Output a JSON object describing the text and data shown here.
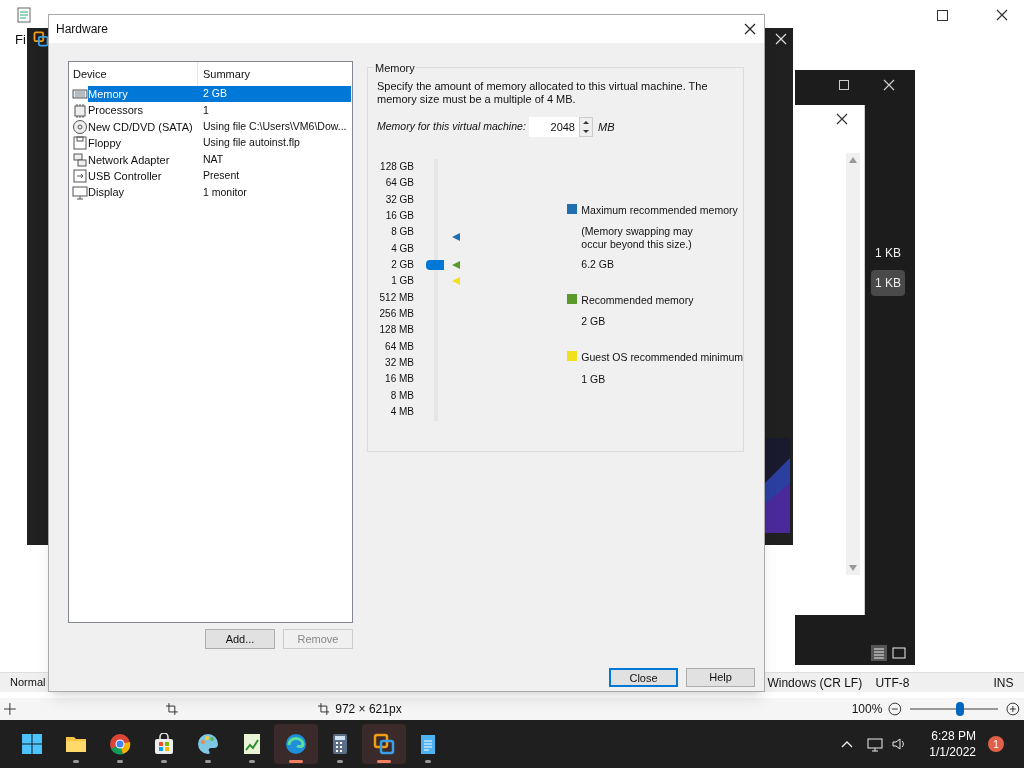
{
  "background_editor": {
    "menu_fragment": "Fi",
    "status_bar": [
      "Normal",
      "Windows (CR LF)",
      "UTF-8",
      "INS"
    ],
    "image_bar": {
      "size": "972 × 621px",
      "zoom": "100%",
      "level": 0.55
    }
  },
  "file_window": {
    "sizes": [
      {
        "text": "1 KB",
        "selected": false
      },
      {
        "text": "1 KB",
        "selected": true
      }
    ]
  },
  "hardware_dialog": {
    "title": "Hardware",
    "columns": [
      "Device",
      "Summary"
    ],
    "devices": [
      {
        "kind": "memory",
        "device": "Memory",
        "summary": "2 GB",
        "selected": true
      },
      {
        "kind": "cpu",
        "device": "Processors",
        "summary": "1",
        "selected": false
      },
      {
        "kind": "disc",
        "device": "New CD/DVD (SATA)",
        "summary": "Using file C:\\Users\\VM6\\Dow...",
        "selected": false
      },
      {
        "kind": "floppy",
        "device": "Floppy",
        "summary": "Using file autoinst.flp",
        "selected": false
      },
      {
        "kind": "network",
        "device": "Network Adapter",
        "summary": "NAT",
        "selected": false
      },
      {
        "kind": "usb",
        "device": "USB Controller",
        "summary": "Present",
        "selected": false
      },
      {
        "kind": "display",
        "device": "Display",
        "summary": "1 monitor",
        "selected": false
      }
    ],
    "list_buttons": [
      {
        "label": "Add...",
        "disabled": false
      },
      {
        "label": "Remove",
        "disabled": true
      }
    ],
    "memory": {
      "group": "Memory",
      "description": "Specify the amount of memory allocated to this virtual machine. The memory size must be a multiple of 4 MB.",
      "field_label": "Memory for this virtual machine:",
      "value": "2048",
      "unit": "MB",
      "scale": [
        "128 GB",
        "64 GB",
        "32 GB",
        "16 GB",
        "8 GB",
        "4 GB",
        "2 GB",
        "1 GB",
        "512 MB",
        "256 MB",
        "128 MB",
        "64 MB",
        "32 MB",
        "16 MB",
        "8 MB",
        "4 MB"
      ],
      "level": 0.6,
      "legend": [
        {
          "title": "Maximum recommended memory",
          "note": "(Memory swapping may occur beyond this size.)",
          "value": "6.2 GB",
          "color": "#1f6fb0"
        },
        {
          "title": "Recommended memory",
          "value": "2 GB",
          "color": "#5a9a2a"
        },
        {
          "title": "Guest OS recommended minimum",
          "value": "1 GB",
          "color": "#f0e020"
        }
      ]
    },
    "footer_buttons": [
      {
        "label": "Close",
        "focused": true
      },
      {
        "label": "Help",
        "focused": false
      }
    ]
  },
  "taskbar": {
    "apps": [
      {
        "kind": "start",
        "selected": false
      },
      {
        "kind": "folder",
        "selected": false
      },
      {
        "kind": "browser",
        "selected": false
      },
      {
        "kind": "store",
        "selected": false
      },
      {
        "kind": "paint",
        "selected": false
      },
      {
        "kind": "chart",
        "selected": false
      },
      {
        "kind": "edge",
        "selected": true
      },
      {
        "kind": "calculator",
        "selected": false
      },
      {
        "kind": "vm",
        "selected": true
      },
      {
        "kind": "notepad",
        "selected": false
      }
    ],
    "time": "6:28 PM",
    "date": "1/1/2022",
    "notifications": "1"
  }
}
